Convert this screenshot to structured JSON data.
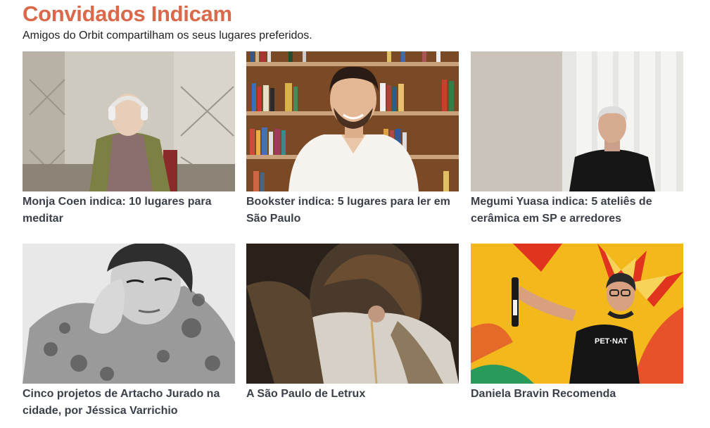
{
  "header": {
    "title": "Convidados Indicam",
    "subtitle": "Amigos do Orbit compartilham os seus lugares preferidos."
  },
  "cards": [
    {
      "caption": "Monja Coen indica: 10 lugares para meditar",
      "image": "portrait-photo"
    },
    {
      "caption": "Bookster indica: 5 lugares para ler em São Paulo",
      "image": "portrait-photo"
    },
    {
      "caption": "Megumi Yuasa indica: 5 ateliês de cerâmica em SP e arredores",
      "image": "portrait-photo"
    },
    {
      "caption": "Cinco projetos de Artacho Jurado na cidade, por Jéssica Varrichio",
      "image": "portrait-photo"
    },
    {
      "caption": "A São Paulo de Letrux",
      "image": "portrait-photo"
    },
    {
      "caption": "Daniela Bravin Recomenda",
      "image": "portrait-photo"
    }
  ],
  "colors": {
    "accent": "#d9694a",
    "caption": "#3a3f4a"
  }
}
